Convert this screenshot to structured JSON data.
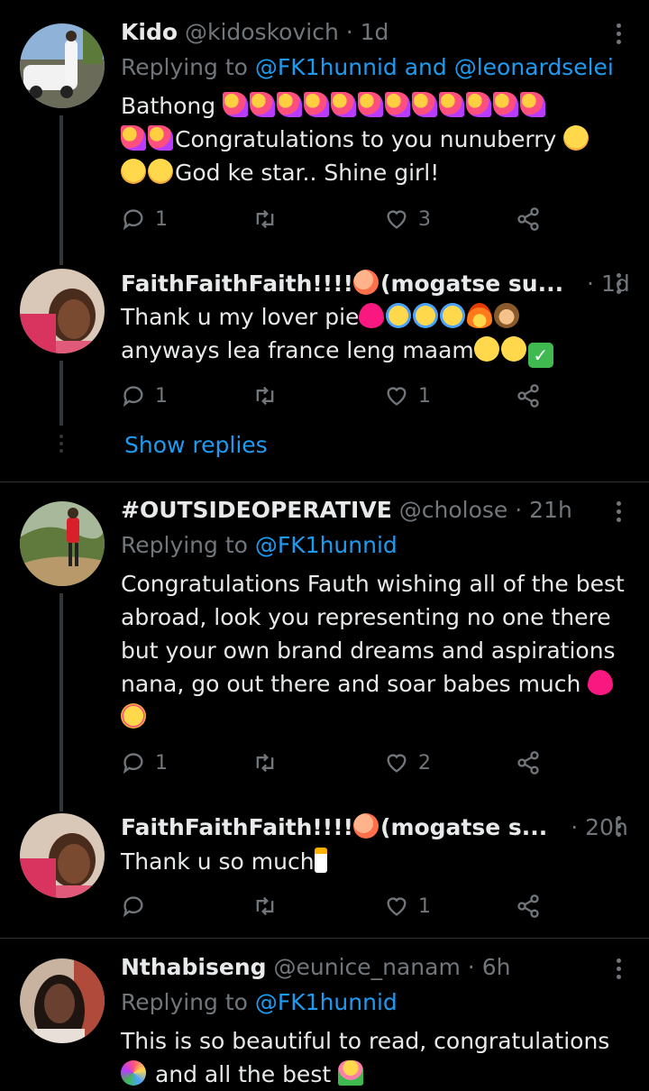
{
  "tweets": [
    {
      "name": "Kido",
      "handle": "@kidoskovich",
      "time": "1d",
      "replying_prefix": "Replying to ",
      "replying_to": "@FK1hunnid and @leonardselei",
      "text_1": "Bathong",
      "text_2": "Congratulations to you nunuberry",
      "text_3": "God ke star.. Shine girl!",
      "replies": "1",
      "retweets": "",
      "likes": "3",
      "avatar_icon": "person-with-car-photo"
    },
    {
      "name": "FaithFaithFaith!!!!",
      "name_suffix": "(mogatse su...",
      "time": "1d",
      "text_1": "Thank u my lover pie",
      "text_2": "anyways lea france leng maam",
      "replies": "1",
      "retweets": "",
      "likes": "1",
      "show_replies": "Show replies",
      "avatar_icon": "selfie-photo"
    },
    {
      "name": "#OUTSIDEOPERATIVE",
      "handle": "@cholose",
      "time": "21h",
      "replying_prefix": "Replying to ",
      "replying_to": "@FK1hunnid",
      "text_1": "Congratulations Fauth wishing all of the best",
      "text_2": "abroad, look you representing no one there",
      "text_3": "but your own brand dreams and aspirations",
      "text_4": "nana, go out there and soar babes much",
      "replies": "1",
      "retweets": "",
      "likes": "2",
      "avatar_icon": "person-on-hill-photo"
    },
    {
      "name": "FaithFaithFaith!!!!",
      "name_suffix": "(mogatse s...",
      "time": "20h",
      "text_1": "Thank u so much",
      "replies": "",
      "retweets": "",
      "likes": "1",
      "avatar_icon": "selfie-photo"
    },
    {
      "name": "Nthabiseng",
      "handle": "@eunice_nanam",
      "time": "6h",
      "replying_prefix": "Replying to ",
      "replying_to": "@FK1hunnid",
      "text_1": "This is so beautiful to read, congratulations",
      "text_2": "and all the best",
      "avatar_icon": "portrait-photo"
    }
  ],
  "dot_separator": "·",
  "colors": {
    "background": "#000000",
    "text": "#e7e9ea",
    "muted": "#71767b",
    "link": "#1d9bf0",
    "divider": "#2f3336"
  }
}
